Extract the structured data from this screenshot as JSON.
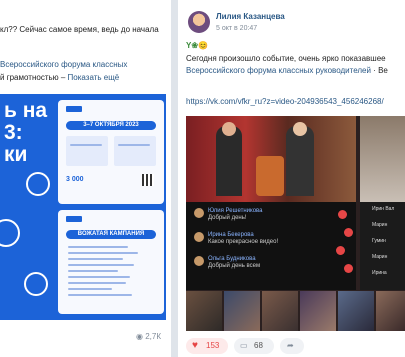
{
  "left_post": {
    "line1": "кл?? Сейчас самое время, ведь до начала",
    "line2_link": "Всероссийского форума классных",
    "line3_text": "й грамотностью – ",
    "line3_link": "Показать ещё",
    "banner": {
      "big_line1": "ь на",
      "big_line2": "3:",
      "big_line3": "ки",
      "dates_pill": "3–7 ОКТЯБРЯ 2023",
      "number": "3 000",
      "section_pill": "ВОЖАТАЯ КАМПАНИЯ"
    },
    "stat": "2,7К"
  },
  "right_post": {
    "author": "Лилия Казанцева",
    "time": "5 окт в 20:47",
    "emoji": "Y❀😊",
    "text_line1": "Сегодня произошло событие, очень ярко показавшее",
    "text_line2_link": "Всероссийского форума классных руководителей",
    "text_line2_tail": " · Ве",
    "url": "https://vk.com/vfkr_ru?z=video-204936543_456246268/",
    "chat": [
      {
        "name": "Юлия Решетникова",
        "text": "Добрый день!"
      },
      {
        "name": "Ирина Бекерова",
        "text": "Какое прекрасное видео!"
      },
      {
        "name": "Ольга Будникова",
        "text": "Добрый день всем"
      }
    ],
    "side_chat": [
      "Ирин Вал",
      "Марин",
      "Гумин",
      "Марин",
      "Ирина"
    ],
    "likes": "153",
    "comments": "68"
  },
  "colors": {
    "brand_blue": "#1c63d8",
    "link": "#2a5885",
    "like_red": "#e64646"
  }
}
